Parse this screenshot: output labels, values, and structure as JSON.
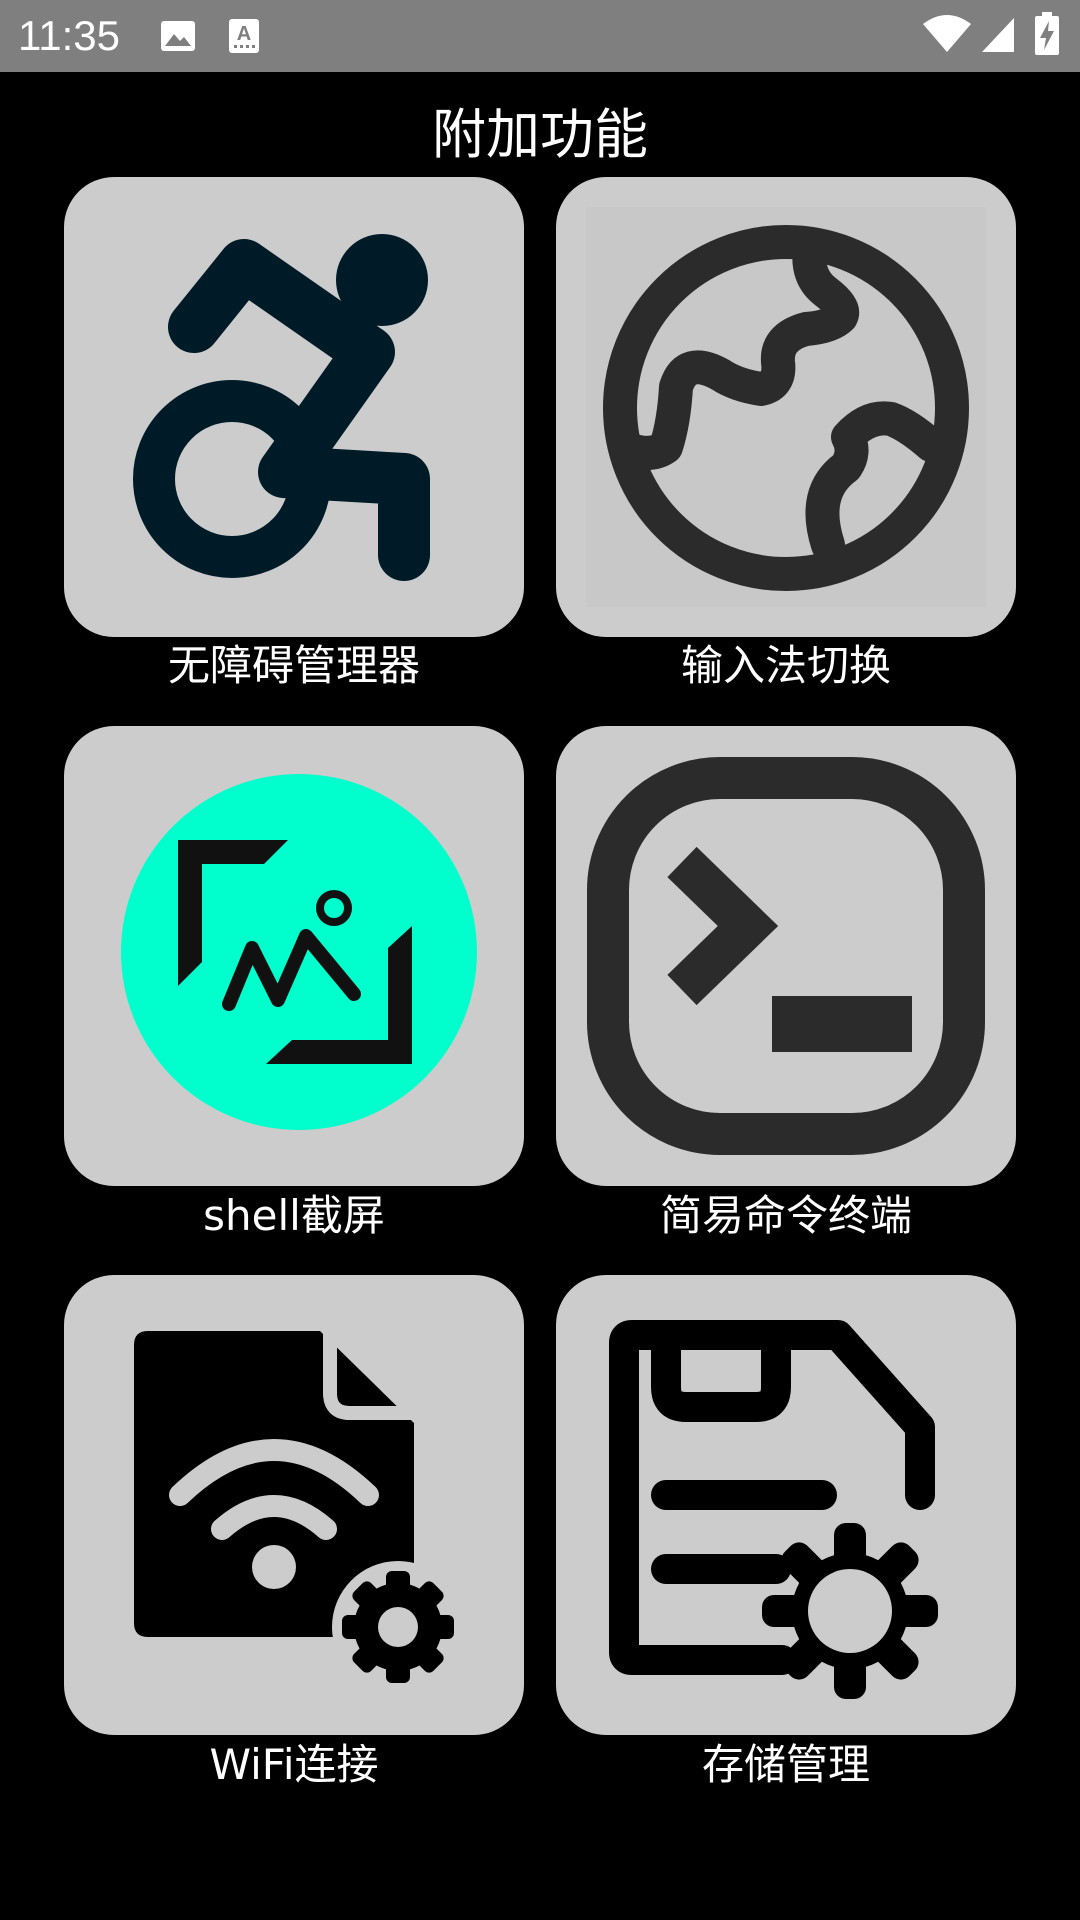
{
  "status_bar": {
    "time": "11:35",
    "background": "#7f7f7f",
    "icons": [
      "image-icon",
      "keyboard-a-icon",
      "wifi-icon",
      "cell-signal-icon",
      "battery-charging-icon"
    ]
  },
  "page": {
    "title": "附加功能",
    "background": "#000000"
  },
  "tiles": [
    {
      "label": "无障碍管理器",
      "icon": "accessibility-icon"
    },
    {
      "label": "输入法切换",
      "icon": "globe-icon"
    },
    {
      "label": "shell截屏",
      "icon": "screenshot-icon",
      "accent": "#00ffcc"
    },
    {
      "label": "简易命令终端",
      "icon": "terminal-icon"
    },
    {
      "label": "WiFi连接",
      "icon": "wifi-file-settings-icon"
    },
    {
      "label": "存储管理",
      "icon": "storage-settings-icon"
    }
  ],
  "colors": {
    "tile_background": "#cccccc",
    "icon_dark": "#2b2b2b",
    "accessibility_icon": "#001b28"
  }
}
